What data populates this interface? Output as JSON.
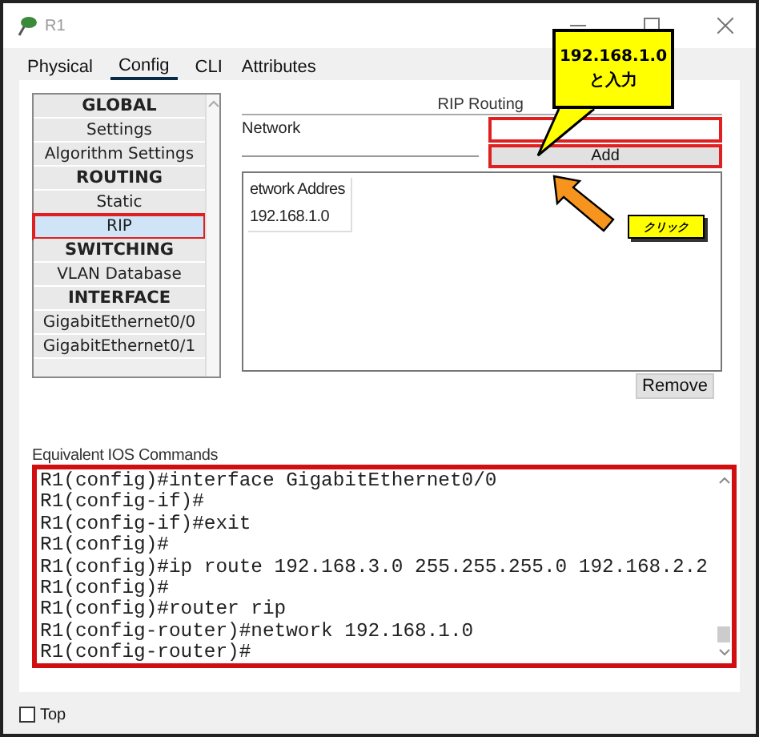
{
  "window": {
    "title": "R1"
  },
  "tabs": [
    {
      "label": "Physical",
      "selected": false
    },
    {
      "label": "Config",
      "selected": true
    },
    {
      "label": "CLI",
      "selected": false
    },
    {
      "label": "Attributes",
      "selected": false
    }
  ],
  "sidebar": {
    "items": [
      {
        "label": "GLOBAL",
        "kind": "header",
        "selected": false,
        "highlighted": false
      },
      {
        "label": "Settings",
        "kind": "item",
        "selected": false,
        "highlighted": false
      },
      {
        "label": "Algorithm Settings",
        "kind": "item",
        "selected": false,
        "highlighted": false
      },
      {
        "label": "ROUTING",
        "kind": "header",
        "selected": false,
        "highlighted": false
      },
      {
        "label": "Static",
        "kind": "item",
        "selected": false,
        "highlighted": false
      },
      {
        "label": "RIP",
        "kind": "item",
        "selected": true,
        "highlighted": true
      },
      {
        "label": "SWITCHING",
        "kind": "header",
        "selected": false,
        "highlighted": false
      },
      {
        "label": "VLAN Database",
        "kind": "item",
        "selected": false,
        "highlighted": false
      },
      {
        "label": "INTERFACE",
        "kind": "header",
        "selected": false,
        "highlighted": false
      },
      {
        "label": "GigabitEthernet0/0",
        "kind": "item",
        "selected": false,
        "highlighted": false
      },
      {
        "label": "GigabitEthernet0/1",
        "kind": "item",
        "selected": false,
        "highlighted": false
      }
    ]
  },
  "rip_panel": {
    "title": "RIP Routing",
    "network_label": "Network",
    "network_highlighted": true,
    "add_button": "Add",
    "add_highlighted": true,
    "table": {
      "columns": [
        "etwork Addres"
      ],
      "rows": [
        "192.168.1.0"
      ]
    },
    "remove_button": "Remove"
  },
  "ios_commands": {
    "label": "Equivalent IOS Commands",
    "highlighted": true,
    "lines": [
      "R1(config)#interface GigabitEthernet0/0",
      "R1(config-if)#",
      "R1(config-if)#exit",
      "R1(config)#",
      "R1(config)#ip route 192.168.3.0 255.255.255.0 192.168.2.2",
      "R1(config)#",
      "R1(config)#router rip",
      "R1(config-router)#network 192.168.1.0",
      "R1(config-router)#"
    ]
  },
  "top_checkbox": {
    "label": "Top",
    "checked": false
  },
  "annotations": [
    {
      "kind": "callout",
      "lines": [
        "192.168.1.0",
        "と入力"
      ]
    },
    {
      "kind": "arrow"
    },
    {
      "kind": "label",
      "lines": [
        "クリック"
      ]
    }
  ]
}
